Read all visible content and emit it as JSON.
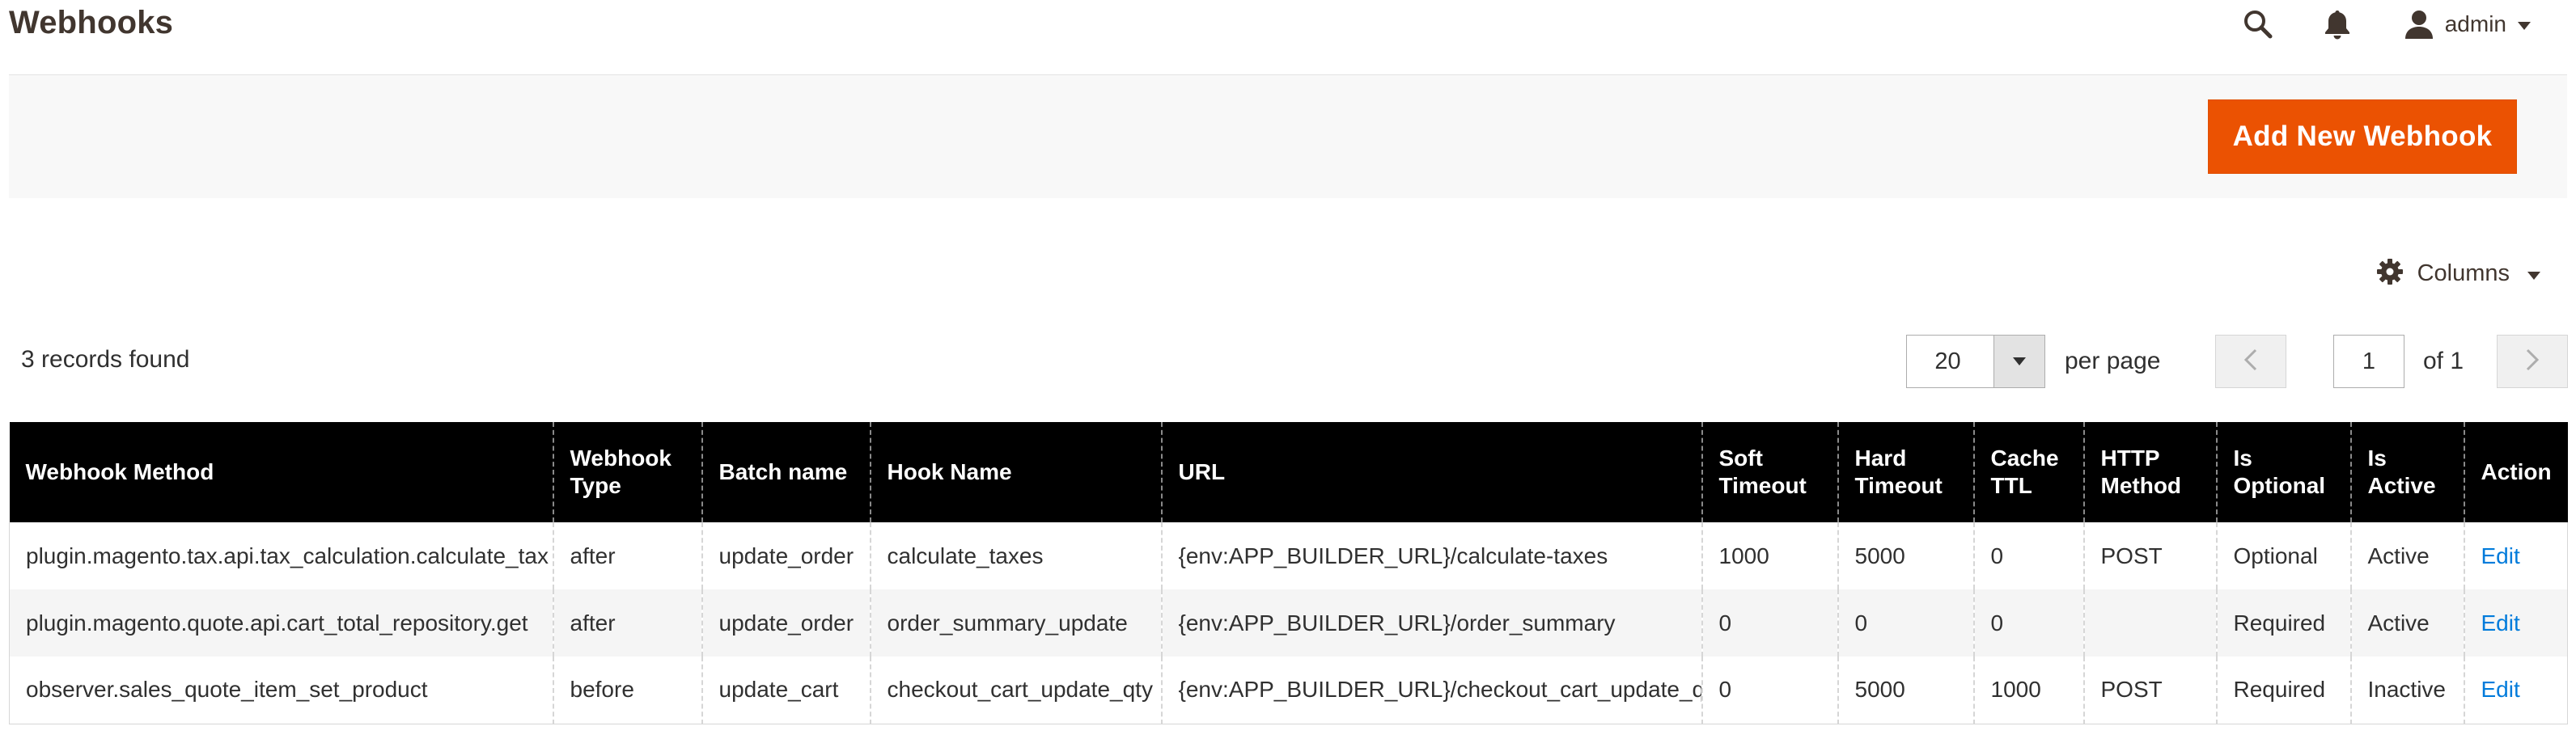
{
  "header": {
    "title": "Webhooks",
    "user": "admin"
  },
  "icons": {
    "search": "search-icon",
    "bell": "bell-icon",
    "user": "user-icon",
    "gear": "gear-icon"
  },
  "colors": {
    "primary_button": "#eb5202",
    "table_header": "#000000",
    "link": "#007bdb"
  },
  "actions": {
    "add_new": "Add New Webhook"
  },
  "grid": {
    "columns_label": "Columns",
    "records_found": "3 records found",
    "per_page_value": "20",
    "per_page_label": "per page",
    "current_page": "1",
    "of_pages": "of 1",
    "headers": [
      "Webhook Method",
      "Webhook Type",
      "Batch name",
      "Hook Name",
      "URL",
      "Soft Timeout",
      "Hard Timeout",
      "Cache TTL",
      "HTTP Method",
      "Is Optional",
      "Is Active",
      "Action"
    ],
    "rows": [
      [
        "plugin.magento.tax.api.tax_calculation.calculate_tax",
        "after",
        "update_order",
        "calculate_taxes",
        "{env:APP_BUILDER_URL}/calculate-taxes",
        "1000",
        "5000",
        "0",
        "POST",
        "Optional",
        "Active",
        "Edit"
      ],
      [
        "plugin.magento.quote.api.cart_total_repository.get",
        "after",
        "update_order",
        "order_summary_update",
        "{env:APP_BUILDER_URL}/order_summary",
        "0",
        "0",
        "0",
        "",
        "Required",
        "Active",
        "Edit"
      ],
      [
        "observer.sales_quote_item_set_product",
        "before",
        "update_cart",
        "checkout_cart_update_qty",
        "{env:APP_BUILDER_URL}/checkout_cart_update_qty",
        "0",
        "5000",
        "1000",
        "POST",
        "Required",
        "Inactive",
        "Edit"
      ]
    ]
  }
}
